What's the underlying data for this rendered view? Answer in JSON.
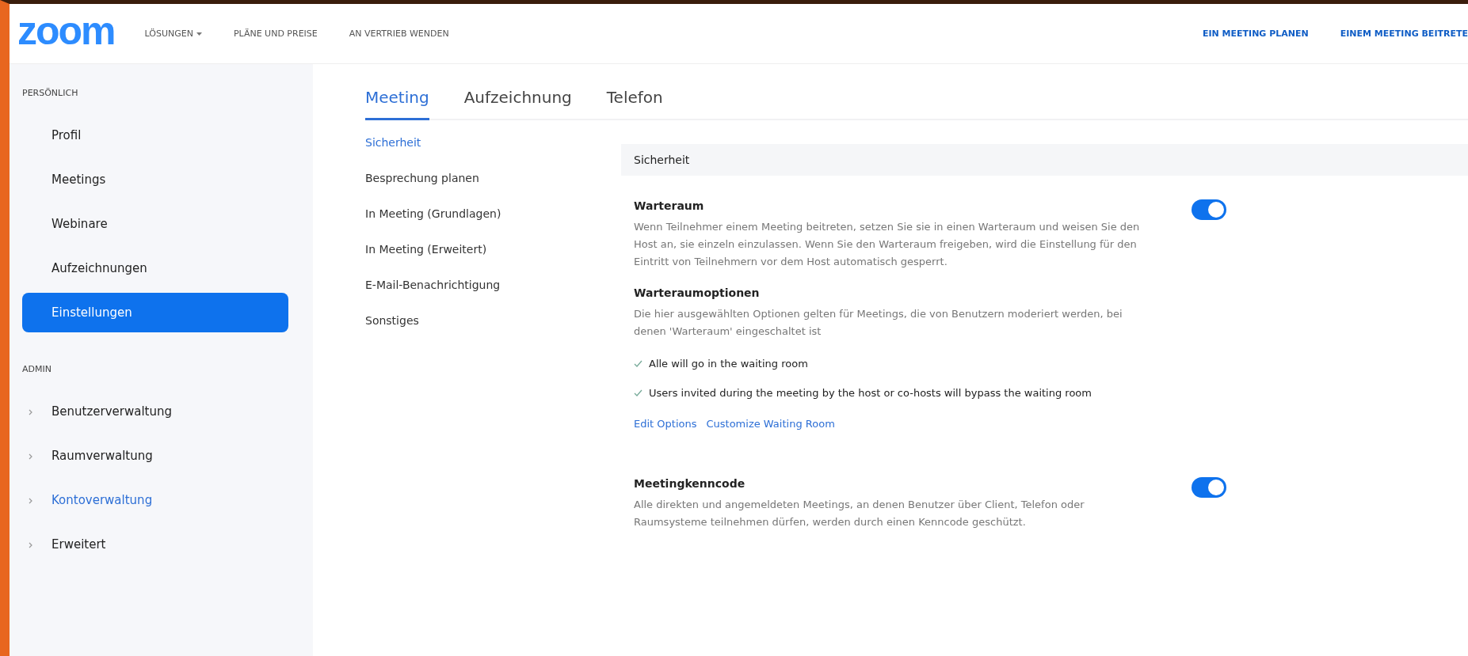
{
  "header": {
    "logo": "zoom",
    "nav": [
      {
        "label": "LÖSUNGEN",
        "dropdown": true
      },
      {
        "label": "PLÄNE UND PREISE",
        "dropdown": false
      },
      {
        "label": "AN VERTRIEB WENDEN",
        "dropdown": false
      }
    ],
    "actions": [
      "EIN MEETING PLANEN",
      "EINEM MEETING BEITRETE"
    ]
  },
  "sidebar": {
    "sections": [
      {
        "title": "PERSÖNLICH",
        "items": [
          {
            "label": "Profil",
            "selected": false,
            "expandable": false,
            "highlighted": false
          },
          {
            "label": "Meetings",
            "selected": false,
            "expandable": false,
            "highlighted": false
          },
          {
            "label": "Webinare",
            "selected": false,
            "expandable": false,
            "highlighted": false
          },
          {
            "label": "Aufzeichnungen",
            "selected": false,
            "expandable": false,
            "highlighted": false
          },
          {
            "label": "Einstellungen",
            "selected": true,
            "expandable": false,
            "highlighted": false
          }
        ]
      },
      {
        "title": "ADMIN",
        "items": [
          {
            "label": "Benutzerverwaltung",
            "selected": false,
            "expandable": true,
            "highlighted": false
          },
          {
            "label": "Raumverwaltung",
            "selected": false,
            "expandable": true,
            "highlighted": false
          },
          {
            "label": "Kontoverwaltung",
            "selected": false,
            "expandable": true,
            "highlighted": true
          },
          {
            "label": "Erweitert",
            "selected": false,
            "expandable": true,
            "highlighted": false
          }
        ]
      }
    ]
  },
  "tabs": [
    {
      "label": "Meeting",
      "selected": true
    },
    {
      "label": "Aufzeichnung",
      "selected": false
    },
    {
      "label": "Telefon",
      "selected": false
    }
  ],
  "subnav": [
    {
      "label": "Sicherheit",
      "selected": true
    },
    {
      "label": "Besprechung planen",
      "selected": false
    },
    {
      "label": "In Meeting (Grundlagen)",
      "selected": false
    },
    {
      "label": "In Meeting (Erweitert)",
      "selected": false
    },
    {
      "label": "E-Mail-Benachrichtigung",
      "selected": false
    },
    {
      "label": "Sonstiges",
      "selected": false
    }
  ],
  "section_title": "Sicherheit",
  "settings": [
    {
      "title": "Warteraum",
      "description": "Wenn Teilnehmer einem Meeting beitreten, setzen Sie sie in einen Warteraum und weisen Sie den Host an, sie einzeln einzulassen. Wenn Sie den Warteraum freigeben, wird die Einstellung für den Eintritt von Teilnehmern vor dem Host automatisch gesperrt.",
      "on": true,
      "options": {
        "title": "Warteraumoptionen",
        "description": "Die hier ausgewählten Optionen gelten für Meetings, die von Benutzern moderiert werden, bei denen 'Warteraum' eingeschaltet ist",
        "items": [
          {
            "label": "Alle will go in the waiting room",
            "checked": true
          },
          {
            "label": "Users invited during the meeting by the host or co-hosts will bypass the waiting room",
            "checked": true
          }
        ],
        "links": [
          "Edit Options",
          "Customize Waiting Room"
        ]
      }
    },
    {
      "title": "Meetingkenncode",
      "description": "Alle direkten und angemeldeten Meetings, an denen Benutzer über Client, Telefon oder Raumsysteme teilnehmen dürfen, werden durch einen Kenncode geschützt.",
      "on": true
    }
  ]
}
